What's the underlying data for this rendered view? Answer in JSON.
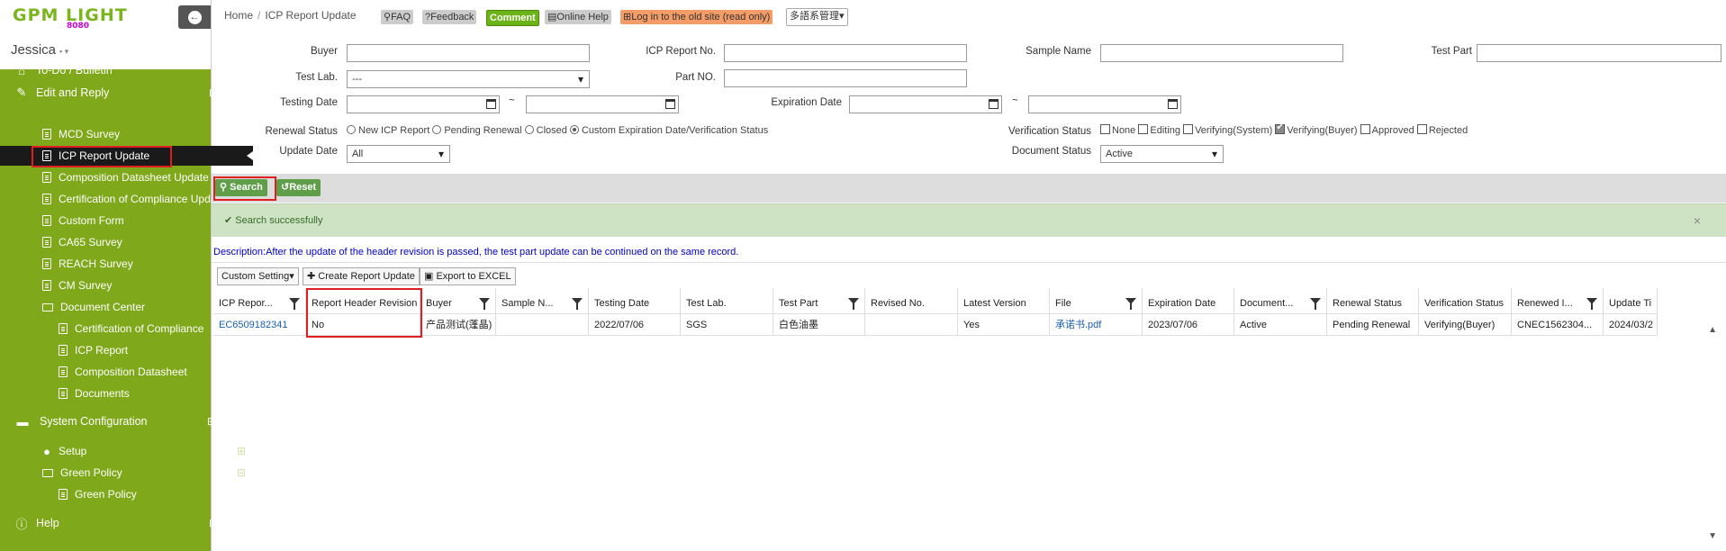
{
  "logo": {
    "text": "GPM LIGHT",
    "sub": "8080"
  },
  "user": {
    "name": "Jessica"
  },
  "sidebar": {
    "items": [
      {
        "label": "To-Do / Bulletin"
      },
      {
        "label": "Edit and Reply",
        "toggle": "⊟"
      },
      {
        "label": "MCD Survey"
      },
      {
        "label": "ICP Report Update"
      },
      {
        "label": "Composition Datasheet Update"
      },
      {
        "label": "Certification of Compliance Update"
      },
      {
        "label": "Custom Form"
      },
      {
        "label": "CA65 Survey"
      },
      {
        "label": "REACH Survey"
      },
      {
        "label": "CM Survey"
      },
      {
        "label": "Document Center",
        "toggle": "⊟"
      },
      {
        "label": "Certification of Compliance"
      },
      {
        "label": "ICP Report"
      },
      {
        "label": "Composition Datasheet"
      },
      {
        "label": "Documents"
      },
      {
        "label": "System Configuration",
        "toggle": "⊟"
      },
      {
        "label": "Setup",
        "toggle": "⊞"
      },
      {
        "label": "Green Policy",
        "toggle": "⊟"
      },
      {
        "label": "Green Policy"
      },
      {
        "label": "Help",
        "toggle": "⊞"
      }
    ]
  },
  "breadcrumb": {
    "home": "Home",
    "sep": "/",
    "current": "ICP Report Update"
  },
  "toolbar": {
    "faq": "FAQ",
    "feedback": "Feedback",
    "comment": "Comment",
    "help": "Online Help",
    "oldsite": "Log in to the old site (read only)",
    "lang": "多語系管理"
  },
  "filters": {
    "buyer": "Buyer",
    "icp_no": "ICP Report No.",
    "sample_name": "Sample Name",
    "test_part": "Test Part",
    "test_lab": "Test Lab.",
    "test_lab_value": "---",
    "part_no": "Part NO.",
    "testing_date": "Testing Date",
    "tilde": "~",
    "expiration_date": "Expiration Date",
    "renewal_status": "Renewal Status",
    "renewal_opts": [
      "New ICP Report",
      "Pending Renewal",
      "Closed",
      "Custom Expiration Date/Verification Status"
    ],
    "verification_status": "Verification Status",
    "verification_opts": [
      "None",
      "Editing",
      "Verifying(System)",
      "Verifying(Buyer)",
      "Approved",
      "Rejected"
    ],
    "update_date": "Update Date",
    "update_date_value": "All",
    "document_status": "Document Status",
    "document_status_value": "Active"
  },
  "actions": {
    "search": "Search",
    "reset": "Reset"
  },
  "message": {
    "success": "Search successfully",
    "close": "×"
  },
  "description": "Description:After the update of the header revision is passed, the test part update can be continued on the same record.",
  "grid_tools": {
    "custom": "Custom Setting",
    "create": "Create Report Update",
    "export": "Export to EXCEL"
  },
  "table": {
    "headers": [
      "ICP Repor...",
      "Report Header Revision",
      "Buyer",
      "Sample N...",
      "Testing Date",
      "Test Lab.",
      "Test Part",
      "Revised No.",
      "Latest Version",
      "File",
      "Expiration Date",
      "Document...",
      "Renewal Status",
      "Verification Status",
      "Renewed I...",
      "Update Ti"
    ],
    "rows": [
      [
        "EC6509182341",
        "No",
        "产品测试(蓬晶)",
        "",
        "2022/07/06",
        "SGS",
        "白色油墨",
        "",
        "Yes",
        "承诺书.pdf",
        "2023/07/06",
        "Active",
        "Pending Renewal",
        "Verifying(Buyer)",
        "CNEC1562304...",
        "2024/03/2"
      ]
    ]
  },
  "colors": {
    "nav_bg": "#7fa81a",
    "active_bg": "#1a1a1a",
    "highlight": "#e02020",
    "success_bg": "#cde3c4",
    "link": "#1a5fb4"
  }
}
